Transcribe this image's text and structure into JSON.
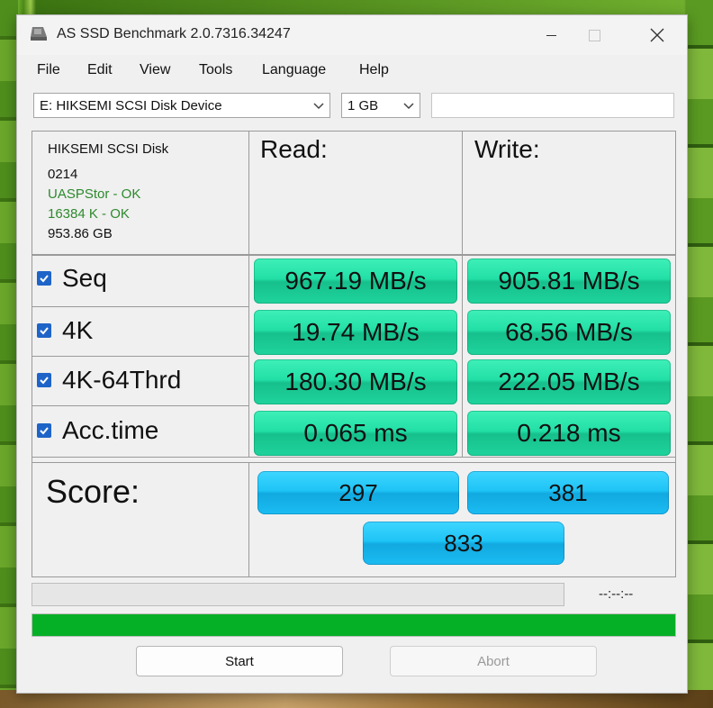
{
  "window": {
    "title": "AS SSD Benchmark 2.0.7316.34247"
  },
  "menu": [
    "File",
    "Edit",
    "View",
    "Tools",
    "Language",
    "Help"
  ],
  "drive_select": {
    "value": "E: HIKSEMI  SCSI Disk Device"
  },
  "size_select": {
    "value": "1 GB"
  },
  "disk_info": {
    "name": "HIKSEMI  SCSI Disk",
    "firmware": "0214",
    "driver": "UASPStor - OK",
    "alignment": "16384 K - OK",
    "capacity": "953.86 GB"
  },
  "headers": {
    "read": "Read:",
    "write": "Write:"
  },
  "tests": [
    {
      "label": "Seq",
      "checked": true,
      "read": "967.19 MB/s",
      "write": "905.81 MB/s"
    },
    {
      "label": "4K",
      "checked": true,
      "read": "19.74 MB/s",
      "write": "68.56 MB/s"
    },
    {
      "label": "4K-64Thrd",
      "checked": true,
      "read": "180.30 MB/s",
      "write": "222.05 MB/s"
    },
    {
      "label": "Acc.time",
      "checked": true,
      "read": "0.065 ms",
      "write": "0.218 ms"
    }
  ],
  "score": {
    "label": "Score:",
    "read": "297",
    "write": "381",
    "total": "833"
  },
  "progress": {
    "time": "--:--:--",
    "test_fraction": 0.0,
    "overall_fraction": 1.0
  },
  "buttons": {
    "start": "Start",
    "abort": "Abort"
  },
  "colors": {
    "result_green": "#22dfa6",
    "score_blue": "#1ec4f6",
    "progress_green": "#06b026",
    "checkbox_blue": "#1e64c8"
  }
}
